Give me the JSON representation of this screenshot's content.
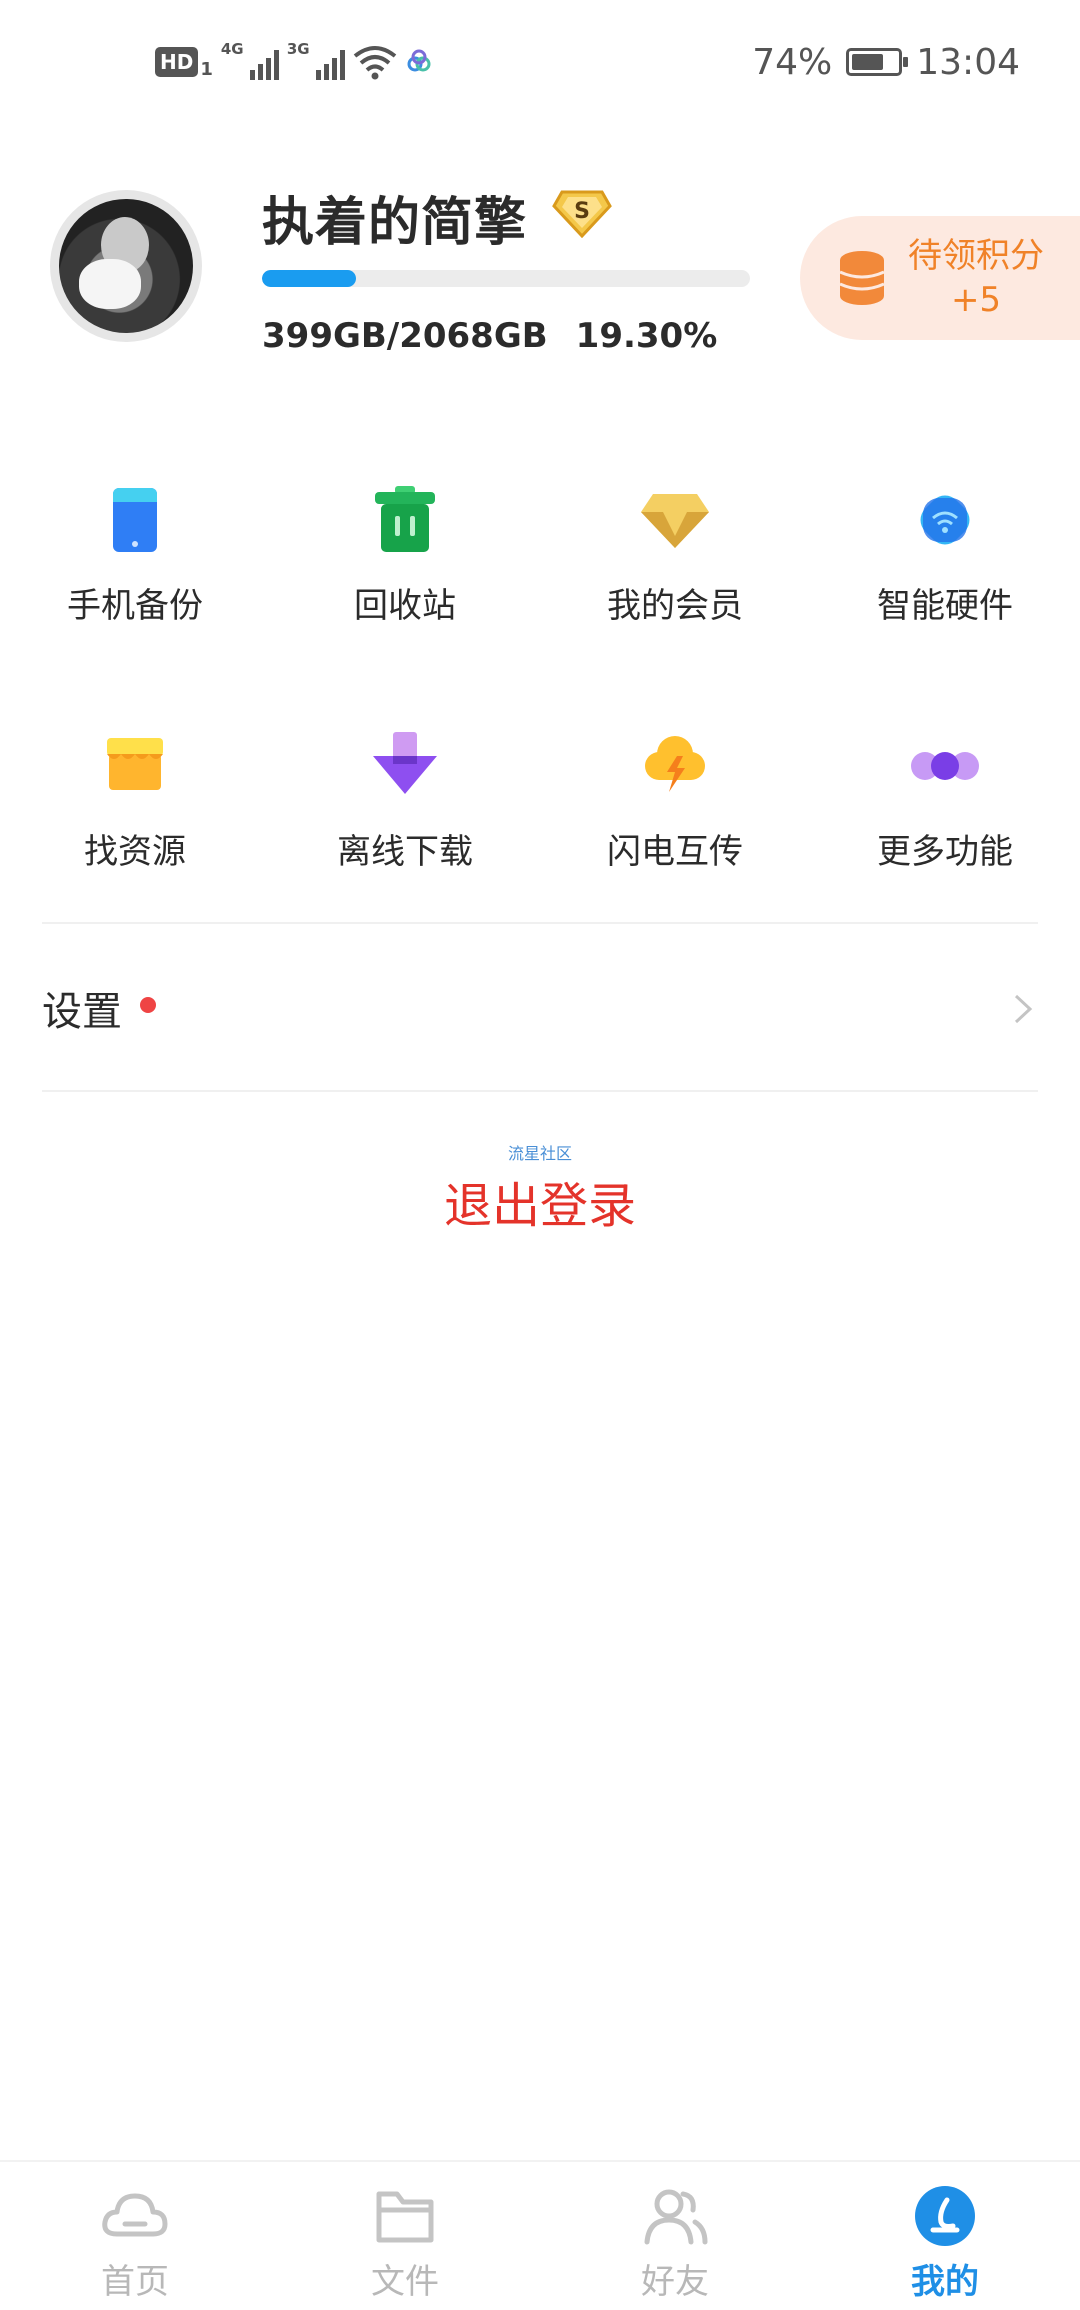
{
  "status_bar": {
    "hd": "HD",
    "hd_sub": "1",
    "net1": "4G",
    "net2": "3G",
    "battery_percent": "74%",
    "battery_level": 0.74,
    "time": "13:04"
  },
  "profile": {
    "username": "执着的简擎",
    "vip_badge": "S",
    "storage_used": "399GB/2068GB",
    "storage_percent_text": "19.30%",
    "storage_fraction": 0.193,
    "points_label": "待领积分",
    "points_value": "+5"
  },
  "grid": [
    {
      "label": "手机备份",
      "icon": "phone-backup-icon"
    },
    {
      "label": "回收站",
      "icon": "recycle-bin-icon"
    },
    {
      "label": "我的会员",
      "icon": "diamond-icon"
    },
    {
      "label": "智能硬件",
      "icon": "smart-hardware-icon"
    },
    {
      "label": "找资源",
      "icon": "store-icon"
    },
    {
      "label": "离线下载",
      "icon": "download-icon"
    },
    {
      "label": "闪电互传",
      "icon": "lightning-cloud-icon"
    },
    {
      "label": "更多功能",
      "icon": "more-dots-icon"
    }
  ],
  "settings": {
    "label": "设置"
  },
  "logout": {
    "watermark": "流星社区",
    "label": "退出登录"
  },
  "nav": {
    "items": [
      {
        "label": "首页",
        "icon": "cloud-icon"
      },
      {
        "label": "文件",
        "icon": "folder-icon"
      },
      {
        "label": "好友",
        "icon": "friends-icon"
      },
      {
        "label": "我的",
        "icon": "profile-icon"
      }
    ],
    "active_index": 3
  },
  "colors": {
    "accent": "#1f8fe6",
    "logout": "#e4332a",
    "points": "#f08228"
  }
}
